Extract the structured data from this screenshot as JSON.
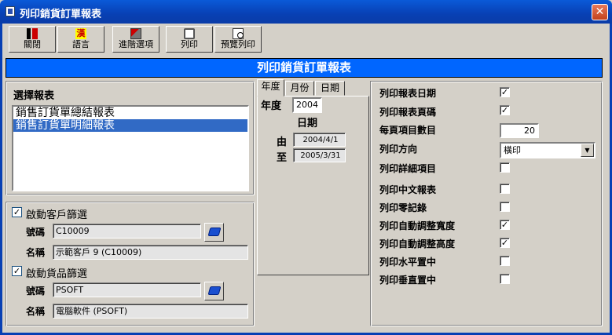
{
  "window": {
    "title": "列印銷貨訂單報表",
    "close_symbol": "✕"
  },
  "toolbar": {
    "close_label": "關閉",
    "language_label": "語言",
    "language_glyph": "漢",
    "advanced_label": "進階選項",
    "print_label": "列印",
    "preview_label": "預覽列印"
  },
  "banner": {
    "title": "列印銷貨訂單報表"
  },
  "report_select": {
    "heading": "選擇報表",
    "items": [
      {
        "label": "銷售訂貨單總結報表"
      },
      {
        "label": "銷售訂貨單明細報表"
      }
    ]
  },
  "filters": {
    "customer_enable_label": "啟動客戶篩選",
    "customer_enabled_mark": "✓",
    "customer_code_label": "號碼",
    "customer_code_value": "C10009",
    "customer_name_label": "名稱",
    "customer_name_value": "示範客戶 9 (C10009)",
    "product_enable_label": "啟動貨品篩選",
    "product_enabled_mark": "✓",
    "product_code_label": "號碼",
    "product_code_value": "PSOFT",
    "product_name_label": "名稱",
    "product_name_value": "電腦軟件 (PSOFT)"
  },
  "date_tabs": {
    "tabs": [
      "年度",
      "月份",
      "日期"
    ],
    "year_label": "年度",
    "year_value": "2004",
    "date_heading": "日期",
    "from_label": "由",
    "from_value": "2004/4/1",
    "to_label": "至",
    "to_value": "2005/3/31"
  },
  "options": {
    "print_report_date_label": "列印報表日期",
    "print_report_date_mark": "✓",
    "print_page_number_label": "列印報表頁碼",
    "print_page_number_mark": "✓",
    "items_per_page_label": "每頁項目數目",
    "items_per_page_value": "20",
    "print_orientation_label": "列印方向",
    "print_orientation_value": "橫印",
    "print_details_label": "列印詳細項目",
    "print_details_mark": "",
    "print_chinese_report_label": "列印中文報表",
    "print_chinese_report_mark": "",
    "print_zero_records_label": "列印零記錄",
    "print_zero_records_mark": "",
    "auto_width_label": "列印自動調整寬度",
    "auto_width_mark": "✓",
    "auto_height_label": "列印自動調整高度",
    "auto_height_mark": "✓",
    "center_horizontal_label": "列印水平置中",
    "center_horizontal_mark": "",
    "center_vertical_label": "列印垂直置中",
    "center_vertical_mark": ""
  }
}
